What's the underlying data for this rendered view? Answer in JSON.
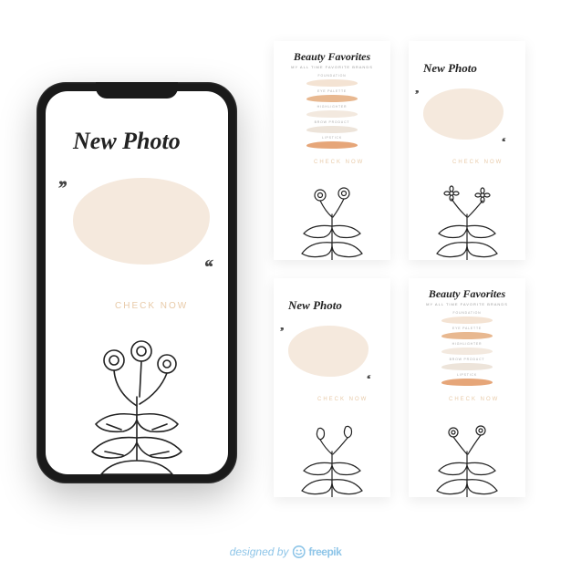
{
  "phone_card": {
    "title": "New Photo",
    "cta": "CHECK NOW"
  },
  "cards": {
    "new_photo": {
      "title": "New Photo",
      "cta": "CHECK NOW"
    },
    "beauty_favorites": {
      "title": "Beauty Favorites",
      "subtitle": "MY ALL TIME FAVORITE BRANDS",
      "cta": "CHECK NOW",
      "items": [
        {
          "label": "FOUNDATION",
          "color": "#f4e3d3"
        },
        {
          "label": "EYE PALETTE",
          "color": "#e8b890"
        },
        {
          "label": "HIGHLIGHTER",
          "color": "#f3e9df"
        },
        {
          "label": "BROW PRODUCT",
          "color": "#ede4da"
        },
        {
          "label": "LIPSTICK",
          "color": "#e6a679"
        }
      ]
    }
  },
  "attribution": {
    "prefix": "designed by",
    "brand": "freepik"
  },
  "colors": {
    "blob": "#f5e9dd",
    "cta": "#e8caa8",
    "attribution": "#8ec5e8"
  }
}
